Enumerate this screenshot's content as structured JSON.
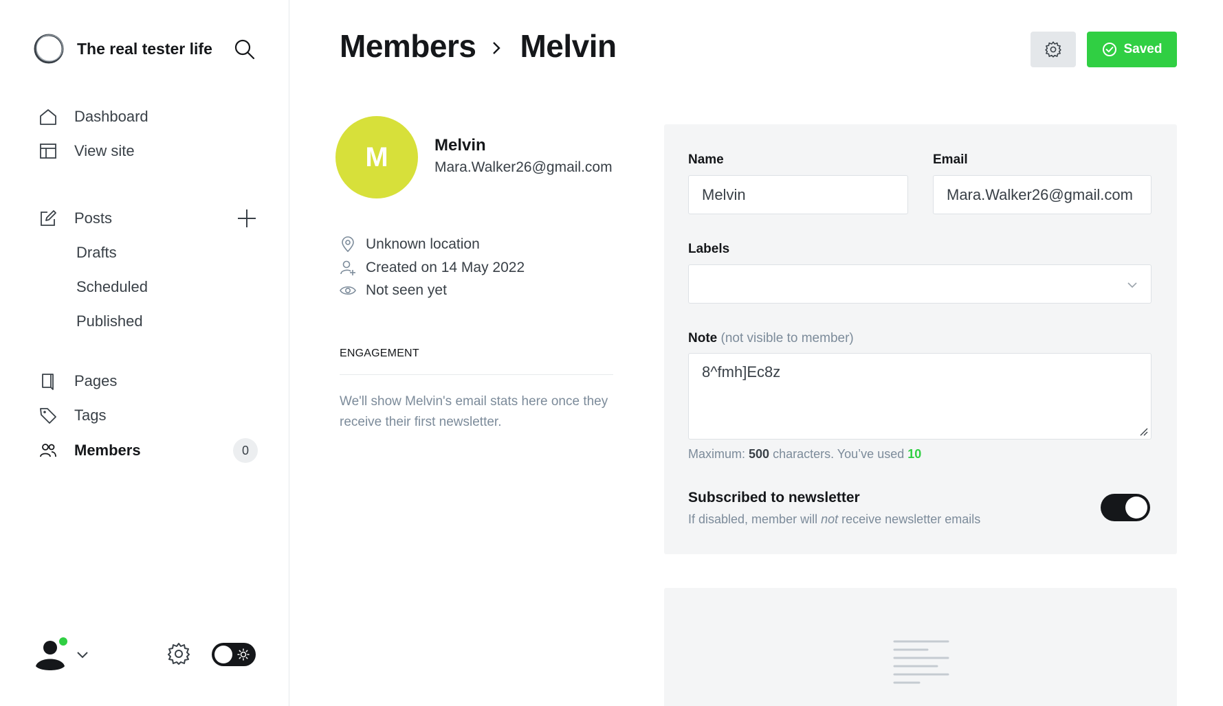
{
  "sidebar": {
    "brand": {
      "title": "The real tester life",
      "logo_icon": "ghost-ring-icon"
    },
    "nav": {
      "dashboard": "Dashboard",
      "view_site": "View site",
      "posts": "Posts",
      "drafts": "Drafts",
      "scheduled": "Scheduled",
      "published": "Published",
      "pages": "Pages",
      "tags": "Tags",
      "members": "Members",
      "members_count": "0"
    }
  },
  "header": {
    "breadcrumb_parent": "Members",
    "breadcrumb_current": "Melvin",
    "saved_label": "Saved"
  },
  "member": {
    "initial": "M",
    "name": "Melvin",
    "email": "Mara.Walker26@gmail.com",
    "location": "Unknown location",
    "created": "Created on 14 May 2022",
    "last_seen": "Not seen yet",
    "avatar_color": "#d7e03a"
  },
  "engagement": {
    "heading": "ENGAGEMENT",
    "text": "We'll show Melvin's email stats here once they receive their first newsletter."
  },
  "form": {
    "name_label": "Name",
    "name_value": "Melvin",
    "email_label": "Email",
    "email_value": "Mara.Walker26@gmail.com",
    "labels_label": "Labels",
    "labels_value": "",
    "note_label": "Note",
    "note_hint": "(not visible to member)",
    "note_value": "8^fmh]Ec8z",
    "counter_prefix": "Maximum:",
    "counter_max": "500",
    "counter_mid": "characters. You’ve used",
    "counter_used": "10",
    "newsletter_title": "Subscribed to newsletter",
    "newsletter_desc_pre": "If disabled, member will",
    "newsletter_desc_em": "not",
    "newsletter_desc_post": "receive newsletter emails",
    "newsletter_enabled": true
  },
  "colors": {
    "accent_green": "#30cf43",
    "dark": "#15171a",
    "card_bg": "#f4f5f6"
  }
}
